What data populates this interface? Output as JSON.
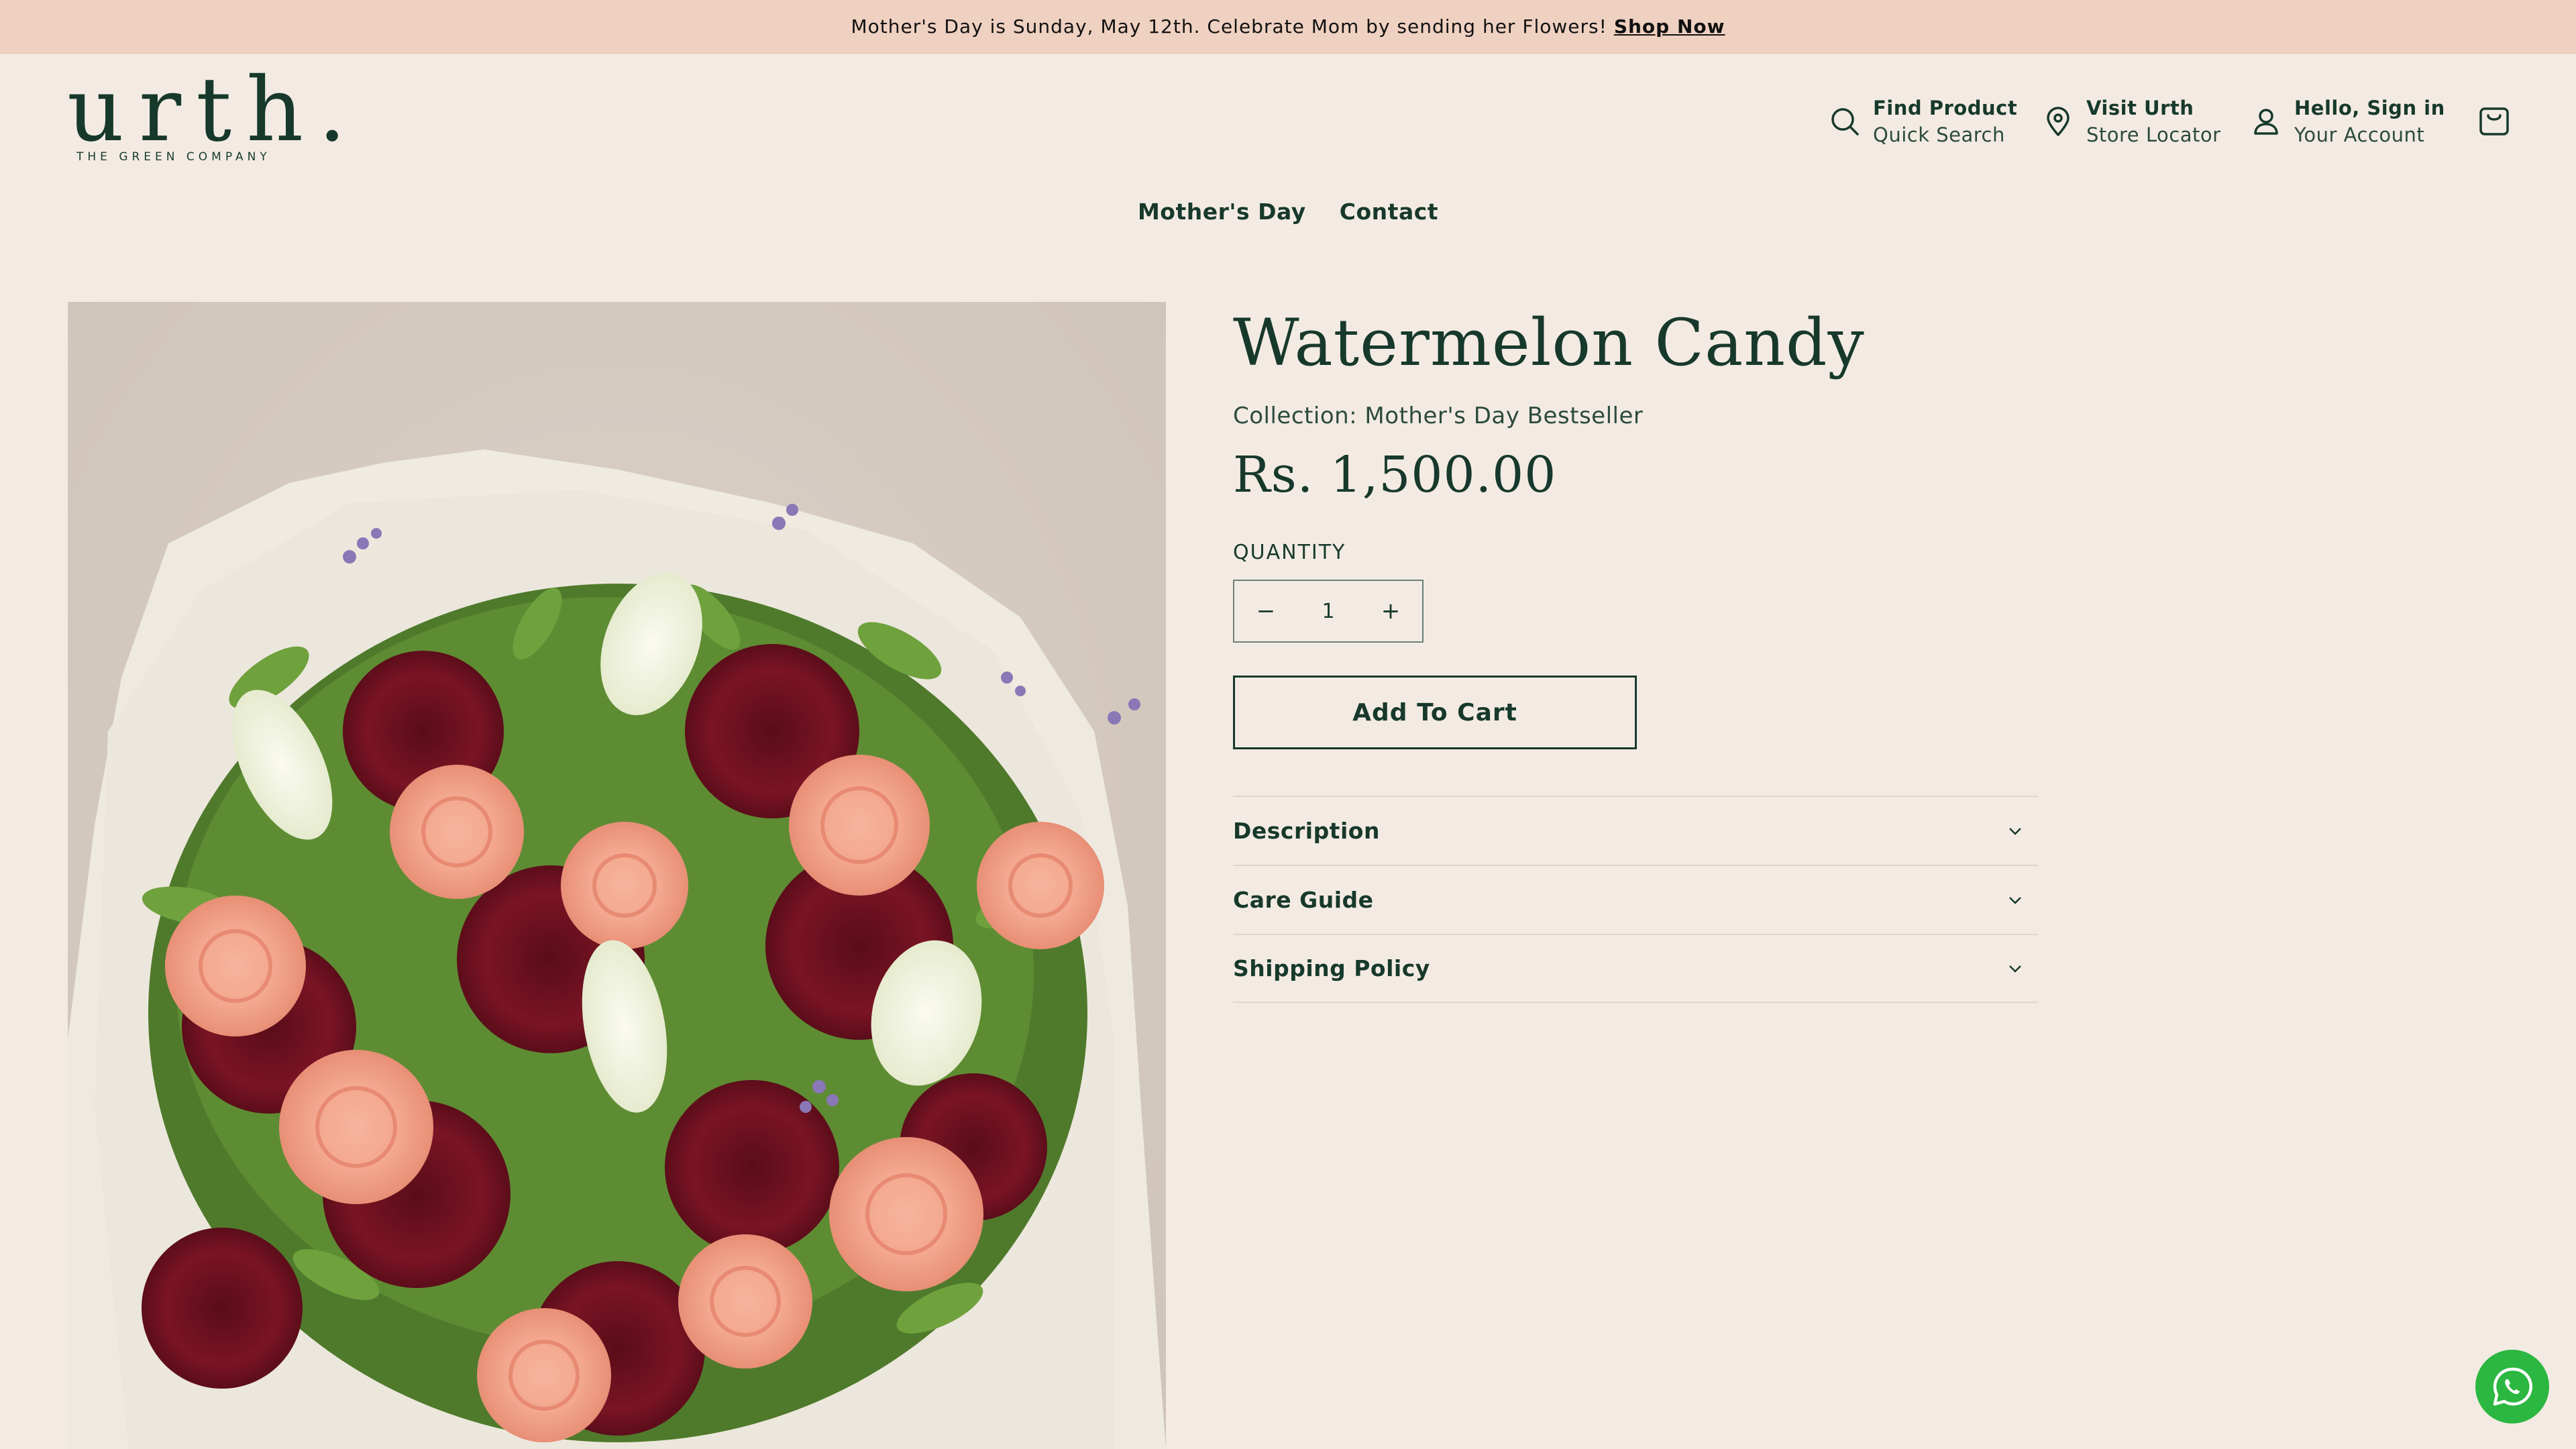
{
  "announcement": {
    "message": "Mother's Day is Sunday, May 12th. Celebrate Mom by sending her Flowers!",
    "link": "Shop Now"
  },
  "logo": {
    "wordmark": "urth.",
    "tagline": "THE GREEN COMPANY"
  },
  "header": {
    "search": {
      "title": "Find Product",
      "subtitle": "Quick Search",
      "icon": "search-icon"
    },
    "store": {
      "title": "Visit Urth",
      "subtitle": "Store Locator",
      "icon": "map-pin-icon"
    },
    "account": {
      "title": "Hello, Sign in",
      "subtitle": "Your Account",
      "icon": "user-icon"
    },
    "cart_icon": "shopping-bag-icon"
  },
  "menu": [
    "Mother's Day",
    "Contact"
  ],
  "product": {
    "title": "Watermelon Candy",
    "collection": "Collection: Mother's Day Bestseller",
    "price": "Rs. 1,500.00",
    "quantity_label": "QUANTITY",
    "quantity": "1",
    "minus": "−",
    "plus": "+",
    "add_to_cart": "Add To Cart",
    "image_alt": "bouquet of peach roses, burgundy chrysanthemums and white snapdragons"
  },
  "accordion": [
    "Description",
    "Care Guide",
    "Shipping Policy"
  ],
  "colors": {
    "background": "#f3ebe3",
    "announcement_bg": "#efd1c1",
    "brand_green": "#17392c",
    "whatsapp": "#2bb741"
  },
  "chat_icon": "whatsapp-icon"
}
